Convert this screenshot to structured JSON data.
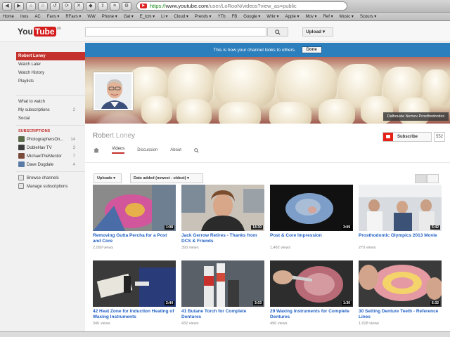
{
  "browser": {
    "url_prefix": "https://",
    "url_host": "www.youtube.com",
    "url_path": "/user/LoRooN/videos?view_as=public",
    "bookmarks": [
      "Home",
      "Inos",
      "AC",
      "Favs ▾",
      "RFavs ▾",
      "WW",
      "Phone ▾",
      "Gal ▾",
      "E_lcm ▾",
      "Li ▾",
      "Cloud ▾",
      "Prends ▾",
      "YTb",
      "FB",
      "Google ▾",
      "Wrkr ▾",
      "Apple ▾",
      "Mov ▾",
      "Ref ▾",
      "Music ▾",
      "Scours ▾"
    ]
  },
  "masthead": {
    "logo_you": "You",
    "logo_tube": "Tube",
    "logo_region": "UK",
    "upload_label": "Upload"
  },
  "sidebar": {
    "items": [
      {
        "label": "Robert Loney"
      },
      {
        "label": "Watch Later"
      },
      {
        "label": "Watch History"
      },
      {
        "label": "Playlists"
      }
    ],
    "what_to_watch": "What to watch",
    "my_subscriptions": "My subscriptions",
    "my_subscriptions_count": "2",
    "social": "Social",
    "subscriptions_header": "SUBSCRIPTIONS",
    "subscriptions": [
      {
        "name": "PhotographersOn...",
        "count": "14",
        "color": "#5a6b4a"
      },
      {
        "name": "DobleHav TV",
        "count": "3",
        "color": "#3d3d3d"
      },
      {
        "name": "MichaelTheMentor",
        "count": "7",
        "color": "#7a4a3a"
      },
      {
        "name": "Dave Dugdale",
        "count": "4",
        "color": "#5a7aa8"
      }
    ],
    "browse_channels": "Browse channels",
    "manage_subscriptions": "Manage subscriptions"
  },
  "channel": {
    "notice_text": "This is how your channel looks to others.",
    "done_label": "Done",
    "banner_credit": "Dalhousie Nemev Prosthodontics",
    "name": "Robert Loney",
    "subscribe_label": "Subscribe",
    "subscriber_count": "552",
    "tabs": {
      "videos": "Videos",
      "discussion": "Discussion",
      "about": "About"
    },
    "filter_uploads": "Uploads ▾",
    "filter_sort": "Date added (newest - oldest) ▾"
  },
  "videos": [
    {
      "title": "Removing Gutta Percha for a Post and Core",
      "views": "2,099 views",
      "duration": "1:08"
    },
    {
      "title": "Jack Gerrow Retires - Thanks from DCS & Friends",
      "views": "393 views",
      "duration": "14:30"
    },
    {
      "title": "Post & Core Impression",
      "views": "1,482 views",
      "duration": "3:09"
    },
    {
      "title": "Prosthodontic Olympics 2013 Movie",
      "views": "270 views",
      "duration": "5:42"
    },
    {
      "title": "42 Heat Zone for Induction Heating of Waxing Instruments",
      "views": "346 views",
      "duration": "2:44"
    },
    {
      "title": "41 Butane Torch for Complete Dentures",
      "views": "432 views",
      "duration": "3:03"
    },
    {
      "title": "29 Waxing Instruments for Complete Dentures",
      "views": "496 views",
      "duration": "1:30"
    },
    {
      "title": "30 Setting Denture Teeth - Reference Lines",
      "views": "1,028 views",
      "duration": "6:32"
    }
  ]
}
